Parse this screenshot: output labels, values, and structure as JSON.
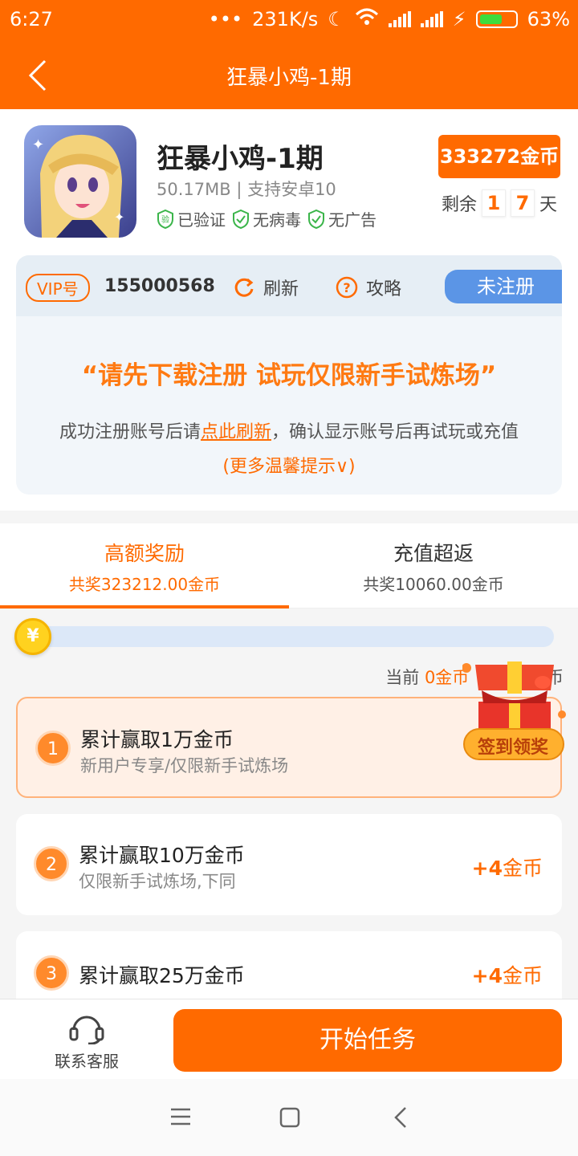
{
  "status": {
    "time": "6:27",
    "dots": "•••",
    "speed": "231K/s",
    "battery": "63%",
    "battery_level": 0.63
  },
  "header": {
    "title": "狂暴小鸡-1期"
  },
  "app": {
    "name": "狂暴小鸡-1期",
    "meta": "50.17MB | 支持安卓10",
    "badges": [
      "已验证",
      "无病毒",
      "无广告"
    ],
    "verified_mark": "验",
    "coins": "333272金币",
    "remain_prefix": "剩余",
    "remain_digits": [
      "1",
      "7"
    ],
    "remain_suffix": "天"
  },
  "vip": {
    "tag": "VIP号",
    "number": "155000568",
    "refresh": "刷新",
    "guide": "攻略",
    "guide_mark": "?",
    "status": "未注册",
    "notice": "“请先下载注册 试玩仅限新手试炼场”",
    "desc_before": "成功注册账号后请",
    "desc_link": "点此刷新",
    "desc_after": "，确认显示账号后再试玩或充值",
    "more": "(更多温馨提示∨)"
  },
  "tabs": [
    {
      "title": "高额奖励",
      "sub": "共奖323212.00金币"
    },
    {
      "title": "充值超返",
      "sub": "共奖10060.00金币"
    }
  ],
  "progress": {
    "yen": "¥",
    "current_label": "当前",
    "current_value": "0金币",
    "current_tail": "币",
    "fill": 0
  },
  "gift": {
    "label": "签到领奖"
  },
  "tasks": [
    {
      "num": "1",
      "name": "累计赢取1万金币",
      "sub": "新用户专享/仅限新手试炼场",
      "reward_num": "",
      "reward_unit": ""
    },
    {
      "num": "2",
      "name": "累计赢取10万金币",
      "sub": "仅限新手试炼场,下同",
      "reward_num": "+4",
      "reward_unit": "金币"
    },
    {
      "num": "3",
      "name": "累计赢取25万金币",
      "sub": "",
      "reward_num": "+4",
      "reward_unit": "金币"
    }
  ],
  "bottom": {
    "service": "联系客服",
    "start": "开始任务"
  },
  "colors": {
    "accent": "#ff6a00",
    "vip_blue": "#5b95e6",
    "coin_yellow": "#ffd21f"
  }
}
